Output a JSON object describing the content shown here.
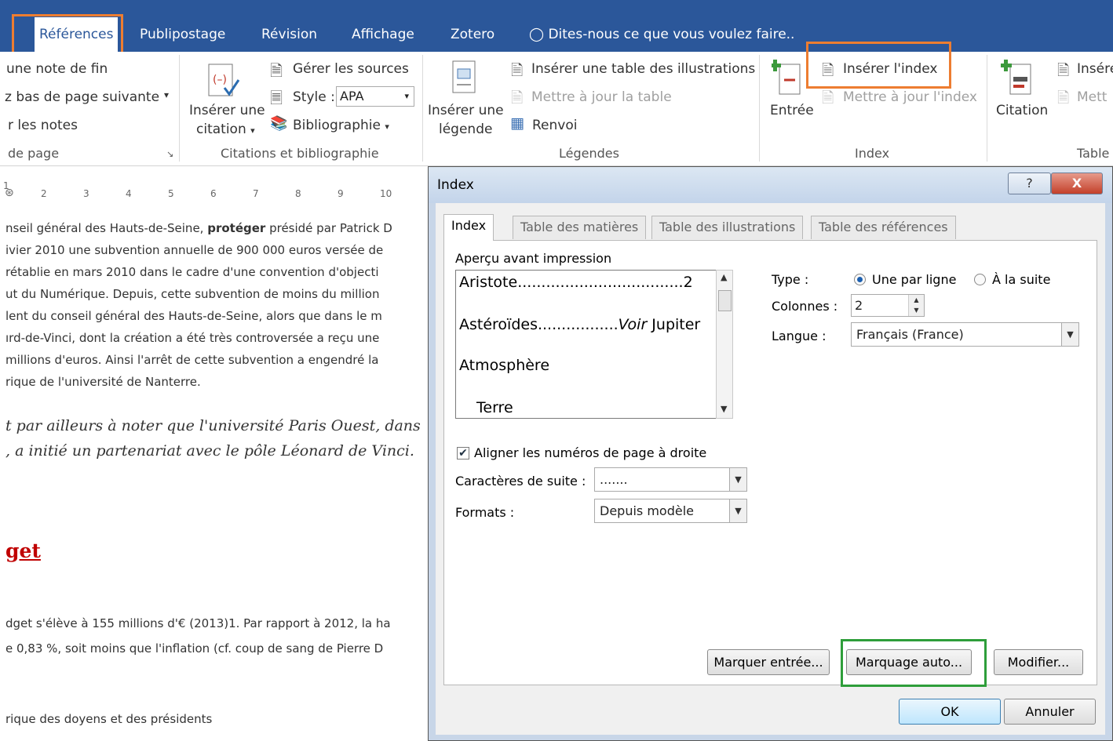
{
  "ribbon_tabs": [
    "Références",
    "Publipostage",
    "Révision",
    "Affichage",
    "Zotero"
  ],
  "tell_me": "Dites-nous ce que vous voulez faire..",
  "ribbon": {
    "footnotes": {
      "end_note": "une note de fin",
      "next_footnote": "z bas de page suivante",
      "show_notes": "r les notes",
      "group_label": "de page"
    },
    "citations": {
      "insert_citation_line1": "Insérer une",
      "insert_citation_line2": "citation",
      "manage_sources": "Gérer les sources",
      "style_label": "Style :",
      "style_value": "APA",
      "bibliography": "Bibliographie",
      "group_label": "Citations et bibliographie"
    },
    "captions": {
      "insert_caption_line1": "Insérer une",
      "insert_caption_line2": "légende",
      "insert_table_figures": "Insérer une table des illustrations",
      "update_table": "Mettre à jour la table",
      "cross_reference": "Renvoi",
      "group_label": "Légendes"
    },
    "index": {
      "mark_entry": "Entrée",
      "insert_index": "Insérer l'index",
      "update_index": "Mettre à jour l'index",
      "group_label": "Index"
    },
    "toa": {
      "mark_citation": "Citation",
      "insert": "Inséré",
      "update": "Mett",
      "group_label": "Table"
    }
  },
  "ruler_ticks": [
    "1",
    "2",
    "3",
    "4",
    "5",
    "6",
    "7",
    "8",
    "9",
    "10"
  ],
  "document": {
    "lines": [
      "nseil général des Hauts-de-Seine, ",
      "ivier 2010 une subvention annuelle de 900 000 euros versée de",
      "rétablie en mars 2010 dans le cadre d'une convention d'objecti",
      "ut du Numérique. Depuis, cette subvention de moins du million",
      "lent du conseil général des Hauts-de-Seine, alors que dans le m",
      "ırd-de-Vinci, dont la création a été très controversée a reçu une",
      "millions d'euros. Ainsi l'arrêt de cette subvention a engendré la",
      "rique de l'université de Nanterre."
    ],
    "bold_word": "protéger",
    "line1_tail": " présidé par Patrick D",
    "script_lines": [
      "t par ailleurs à noter que l'université Paris Ouest, dans",
      ", a initié un partenariat avec le pôle Léonard de Vinci."
    ],
    "heading": "get",
    "budget_lines": [
      "dget s'élève à 155 millions d'€ (2013)1. Par rapport à 2012, la ha",
      "e 0,83 %, soit moins que l'inflation (cf. coup de sang de Pierre D"
    ],
    "last_line": "rique des doyens et des présidents"
  },
  "dialog": {
    "title": "Index",
    "help": "?",
    "close": "X",
    "tabs": [
      "Index",
      "Table des matières",
      "Table des illustrations",
      "Table des références"
    ],
    "preview_label": "Aperçu avant impression",
    "preview_lines": {
      "aristote": "Aristote...................................2",
      "asteroides_dots": "Astéroïdes.................",
      "asteroides_voir": "Voir",
      "asteroides_target": " Jupiter",
      "atmosphere": "Atmosphère",
      "terre": "Terre"
    },
    "type_label": "Type :",
    "type_option1": "Une par ligne",
    "type_option2": "À la suite",
    "columns_label": "Colonnes :",
    "columns_value": "2",
    "language_label": "Langue :",
    "language_value": "Français (France)",
    "align_label": "Aligner les numéros de page à droite",
    "tab_leader_label": "Caractères de suite :",
    "tab_leader_value": ".......",
    "formats_label": "Formats :",
    "formats_value": "Depuis modèle",
    "btn_mark_entry": "Marquer entrée...",
    "btn_automark": "Marquage auto...",
    "btn_modify": "Modifier...",
    "btn_ok": "OK",
    "btn_cancel": "Annuler"
  },
  "colors": {
    "ribbon_blue": "#2b579a",
    "highlight_orange": "#ed7d31",
    "highlight_green": "#2e9e3a",
    "heading_red": "#c00000"
  }
}
